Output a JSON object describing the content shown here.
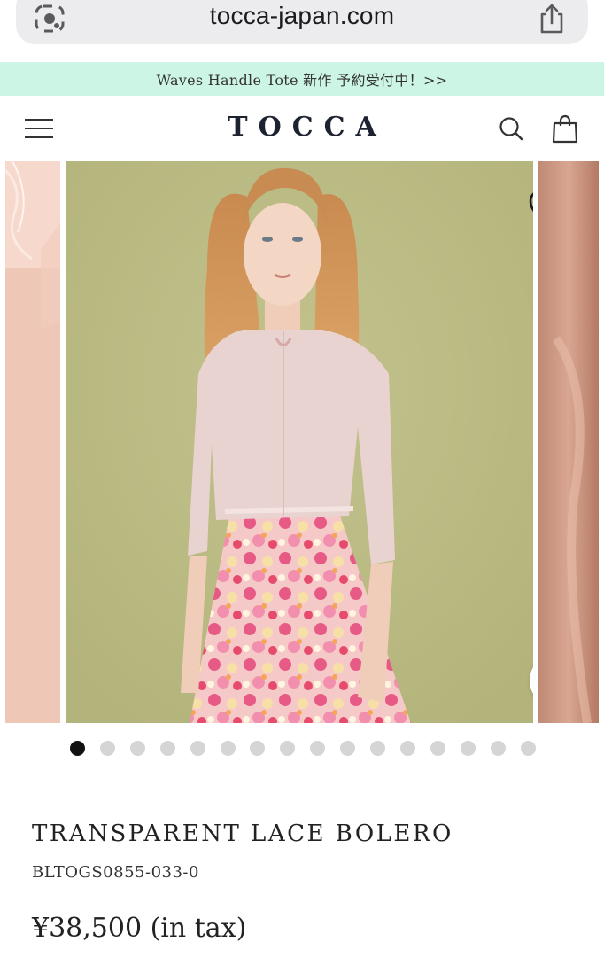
{
  "browser": {
    "url": "tocca-japan.com"
  },
  "announcement": {
    "text": "Waves Handle Tote 新作 予約受付中！>>",
    "background": "#cdf5e5"
  },
  "header": {
    "logo": "TOCCA",
    "icons": [
      "menu-icon",
      "search-icon",
      "shopping-bag-icon"
    ]
  },
  "carousel": {
    "slide_count": 16,
    "active_index": 0,
    "icons": [
      "heart-icon",
      "zoom-icon"
    ]
  },
  "product": {
    "name": "TRANSPARENT LACE BOLERO",
    "code": "BLTOGS0855-033-0",
    "price": "¥38,500 (in tax)"
  },
  "colors": {
    "logo": "#1c2230",
    "announcement_bg": "#cdf5e5",
    "active_dot": "#111111",
    "inactive_dot": "#d5d5d5"
  }
}
